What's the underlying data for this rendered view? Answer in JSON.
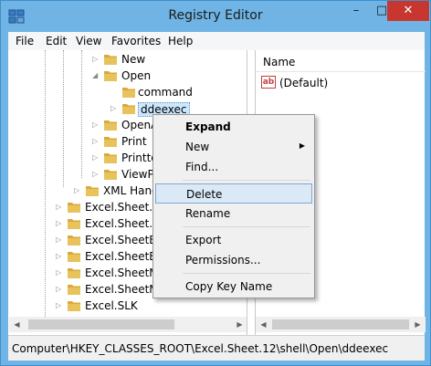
{
  "window": {
    "title": "Registry Editor",
    "minimize_glyph": "–",
    "maximize_glyph": "□",
    "close_glyph": "✕"
  },
  "menubar": {
    "items": [
      "File",
      "Edit",
      "View",
      "Favorites",
      "Help"
    ]
  },
  "tree": {
    "rows": [
      {
        "label": "New",
        "level": 3,
        "arrow": "collapsed"
      },
      {
        "label": "Open",
        "level": 3,
        "arrow": "expanded"
      },
      {
        "label": "command",
        "level": 4,
        "arrow": "none"
      },
      {
        "label": "ddeexec",
        "level": 4,
        "arrow": "collapsed",
        "selected": true
      },
      {
        "label": "OpenA",
        "level": 3,
        "arrow": "collapsed"
      },
      {
        "label": "Print",
        "level": 3,
        "arrow": "collapsed"
      },
      {
        "label": "Printto",
        "level": 3,
        "arrow": "collapsed"
      },
      {
        "label": "ViewPr",
        "level": 3,
        "arrow": "collapsed"
      },
      {
        "label": "XML Hand",
        "level": 2,
        "arrow": "collapsed"
      },
      {
        "label": "Excel.Sheet.5",
        "level": 1,
        "arrow": "collapsed"
      },
      {
        "label": "Excel.Sheet.8",
        "level": 1,
        "arrow": "collapsed"
      },
      {
        "label": "Excel.SheetBin",
        "level": 1,
        "arrow": "collapsed"
      },
      {
        "label": "Excel.SheetBin",
        "level": 1,
        "arrow": "collapsed"
      },
      {
        "label": "Excel.SheetMa",
        "level": 1,
        "arrow": "collapsed"
      },
      {
        "label": "Excel.SheetMa",
        "level": 1,
        "arrow": "collapsed"
      },
      {
        "label": "Excel.SLK",
        "level": 1,
        "arrow": "collapsed"
      }
    ]
  },
  "list": {
    "column_name": "Name",
    "rows": [
      {
        "label": "(Default)",
        "icon": "ab"
      }
    ]
  },
  "context_menu": {
    "items": [
      {
        "label": "Expand",
        "bold": true
      },
      {
        "label": "New",
        "submenu": true
      },
      {
        "label": "Find..."
      },
      {
        "separator": true
      },
      {
        "label": "Delete",
        "hover": true
      },
      {
        "label": "Rename"
      },
      {
        "separator": true
      },
      {
        "label": "Export"
      },
      {
        "label": "Permissions..."
      },
      {
        "separator": true
      },
      {
        "label": "Copy Key Name"
      }
    ]
  },
  "statusbar": {
    "path": "Computer\\HKEY_CLASSES_ROOT\\Excel.Sheet.12\\shell\\Open\\ddeexec"
  },
  "colors": {
    "title_bar": "#6fb4e4",
    "close_button": "#c7372f",
    "selection": "#cce8ff",
    "menu_hover": "#dbe9f7",
    "folder": "#e8c25a"
  }
}
